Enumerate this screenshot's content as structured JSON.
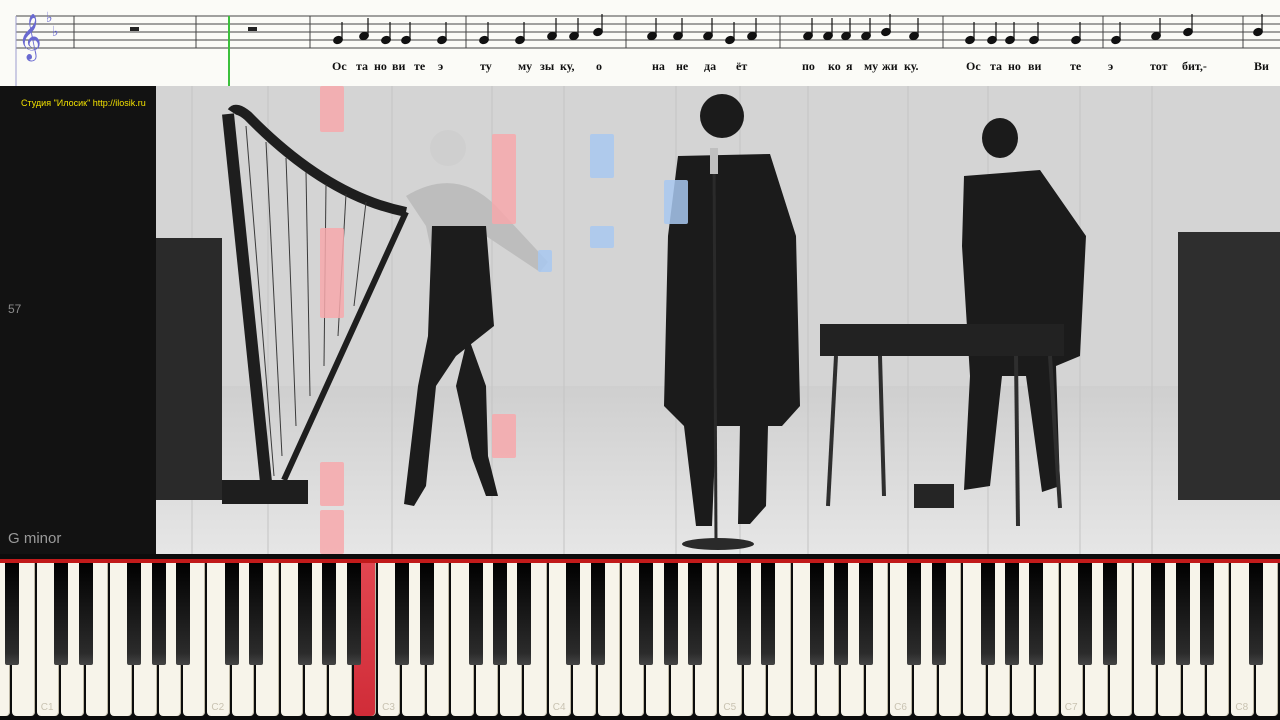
{
  "score": {
    "key_signature": "two flats",
    "lyrics": [
      {
        "text": "Ос"
      },
      {
        "text": "та"
      },
      {
        "text": "но"
      },
      {
        "text": "ви"
      },
      {
        "text": "те"
      },
      {
        "text": "э"
      },
      {
        "text": "ту"
      },
      {
        "text": "му"
      },
      {
        "text": "зы"
      },
      {
        "text": "ку,"
      },
      {
        "text": "о"
      },
      {
        "text": "на"
      },
      {
        "text": "не"
      },
      {
        "text": "да"
      },
      {
        "text": "ёт"
      },
      {
        "text": "по"
      },
      {
        "text": "ко"
      },
      {
        "text": "я"
      },
      {
        "text": "му"
      },
      {
        "text": "жи"
      },
      {
        "text": "ку."
      },
      {
        "text": "Ос"
      },
      {
        "text": "та"
      },
      {
        "text": "но"
      },
      {
        "text": "ви"
      },
      {
        "text": "те"
      },
      {
        "text": "э"
      },
      {
        "text": "тот"
      },
      {
        "text": "бит,-"
      },
      {
        "text": "Ви"
      }
    ]
  },
  "video": {
    "studio_credit": "Студия \"Илосик\" http://ilosik.ru",
    "measure_number": "57",
    "key_name": "G minor"
  },
  "keyboard": {
    "octave_labels": [
      "C1",
      "C2",
      "C3",
      "C4",
      "C5",
      "C6",
      "C7",
      "C8"
    ],
    "active_key": "B2"
  },
  "colors": {
    "accent_red": "#c11a1a",
    "note_pink": "#f7a8ac",
    "note_blue": "#a8c8f0",
    "playhead_green": "#3cc03c"
  }
}
